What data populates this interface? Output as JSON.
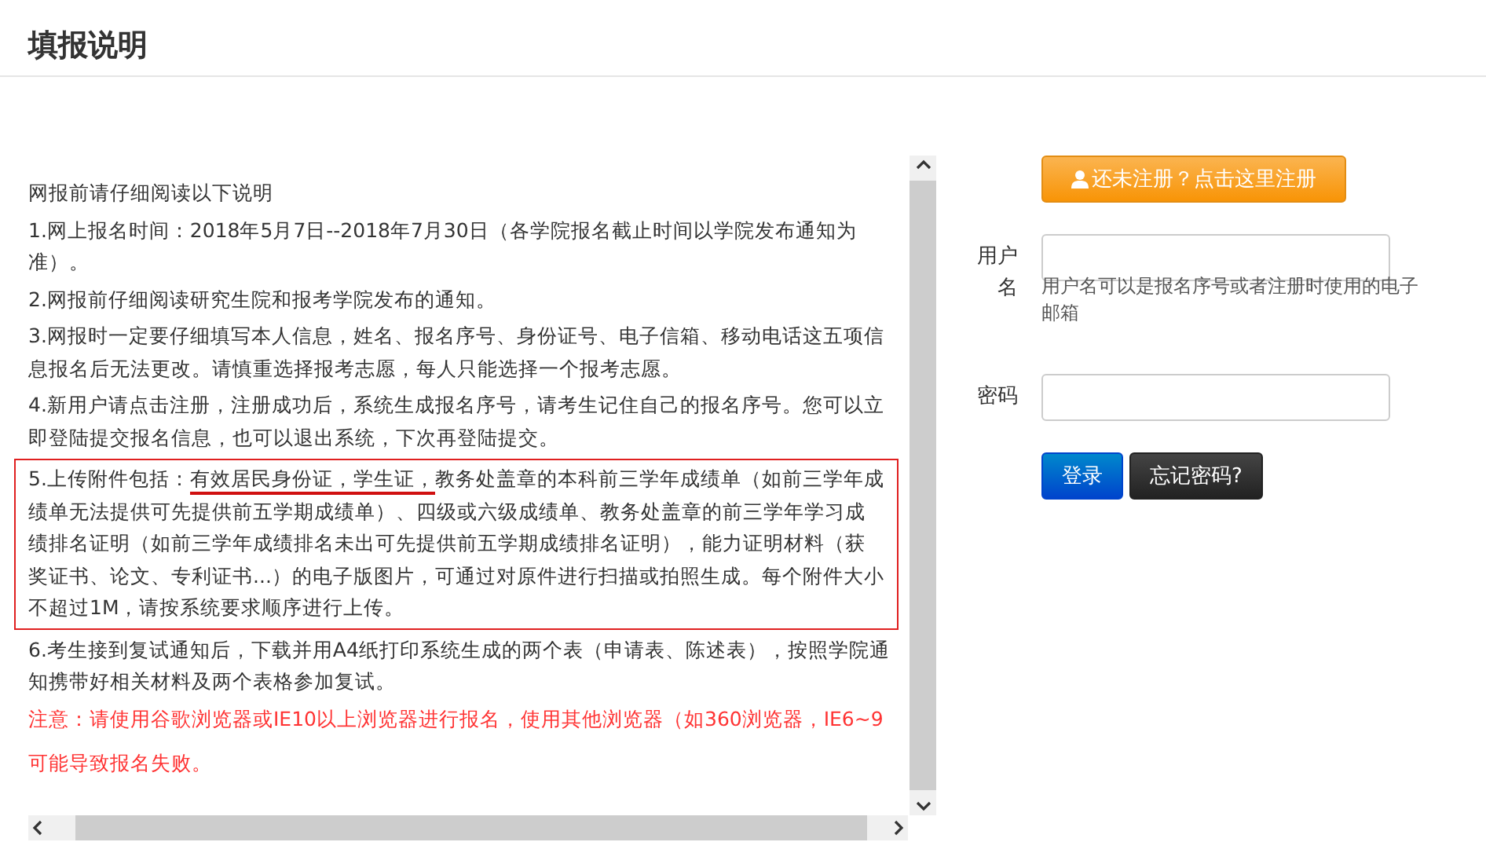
{
  "title": "填报说明",
  "notice": {
    "intro": "网报前请仔细阅读以下说明",
    "items": [
      {
        "kind": "plain",
        "text": "1.网上报名时间：2018年5月7日--2018年7月30日（各学院报名截止时间以学院发布通知为准）。"
      },
      {
        "kind": "plain",
        "text": "2.网报前仔细阅读研究生院和报考学院发布的通知。"
      },
      {
        "kind": "plain",
        "text": "3.网报时一定要仔细填写本人信息，姓名、报名序号、身份证号、电子信箱、移动电话这五项信息报名后无法更改。请慎重选择报考志愿，每人只能选择一个报考志愿。"
      },
      {
        "kind": "plain",
        "text": "4.新用户请点击注册，注册成功后，系统生成报名序号，请考生记住自己的报名序号。您可以立即登陆提交报名信息，也可以退出系统，下次再登陆提交。"
      },
      {
        "kind": "boxed",
        "parts": [
          {
            "text": "5.上传附件包括：",
            "underlined": false
          },
          {
            "text": "有效居民身份证，学生证，",
            "underlined": true
          },
          {
            "text": "教务处盖章的本科前三学年成绩单（如前三学年成绩单无法提供可先提供前五学期成绩单）、四级或六级成绩单、教务处盖章的前三学年学习成绩排名证明（如前三学年成绩排名未出可先提供前五学期成绩排名证明），能力证明材料（获奖证书、论文、专利证书...）的电子版图片，可通过对原件进行扫描或拍照生成。每个附件大小不超过1M，请按系统要求顺序进行上传。",
            "underlined": false
          }
        ]
      },
      {
        "kind": "plain",
        "text": "6.考生接到复试通知后，下载并用A4纸打印系统生成的两个表（申请表、陈述表），按照学院通知携带好相关材料及两个表格参加复试。"
      },
      {
        "kind": "warning",
        "text": "注意：请使用谷歌浏览器或IE10以上浏览器进行报名，使用其他浏览器（如360浏览器，IE6~9"
      },
      {
        "kind": "warning",
        "text": "可能导致报名失败。"
      }
    ]
  },
  "register_button": "还未注册？点击这里注册",
  "form": {
    "username_label": "用户名",
    "username_help": "用户名可以是报名序号或者注册时使用的电子邮箱",
    "password_label": "密码"
  },
  "buttons": [
    {
      "kind": "primary",
      "label": "登录"
    },
    {
      "kind": "dark",
      "label": "忘记密码?"
    }
  ]
}
